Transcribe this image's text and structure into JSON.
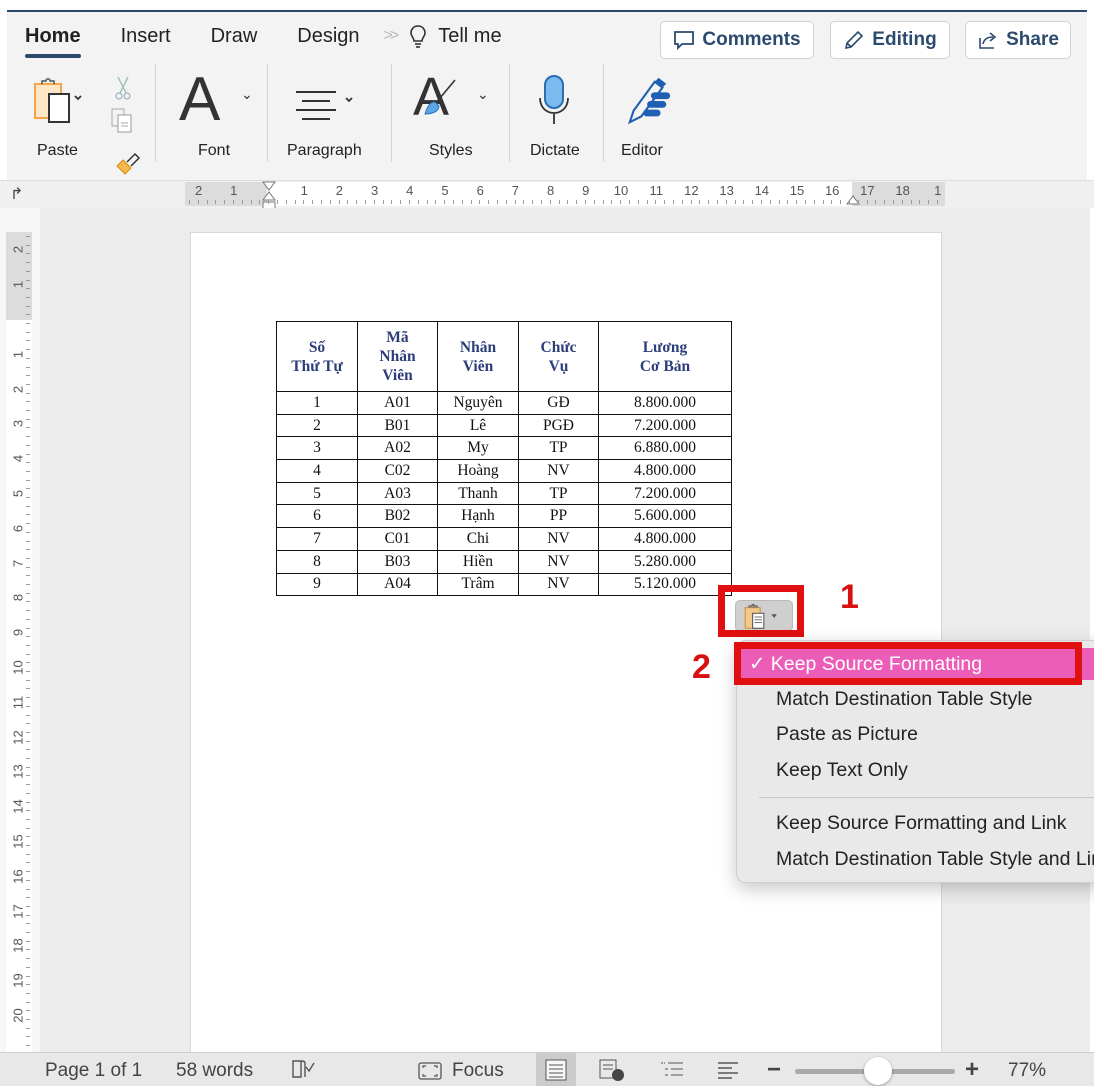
{
  "ribbon": {
    "tabs": [
      {
        "label": "Home",
        "active": true
      },
      {
        "label": "Insert",
        "active": false
      },
      {
        "label": "Draw",
        "active": false
      },
      {
        "label": "Design",
        "active": false
      }
    ],
    "overflow_icon": "double-chevron-right-icon",
    "tell_me": {
      "icon": "lightbulb-icon",
      "label": "Tell me"
    },
    "buttons": {
      "comments": {
        "icon": "comment-icon",
        "label": "Comments"
      },
      "editing": {
        "icon": "pencil-icon",
        "label": "Editing"
      },
      "share": {
        "icon": "share-icon",
        "label": "Share"
      }
    },
    "groups": {
      "paste": {
        "label": "Paste",
        "icon": "clipboard-icon"
      },
      "cut_icon": "scissors-icon",
      "copy_icon": "copy-icon",
      "format_painter_icon": "format-painter-icon",
      "font": {
        "label": "Font",
        "glyph": "A"
      },
      "paragraph": {
        "label": "Paragraph",
        "icon": "align-center-icon"
      },
      "styles": {
        "label": "Styles",
        "glyph": "A"
      },
      "dictate": {
        "label": "Dictate",
        "icon": "microphone-icon"
      },
      "editor": {
        "label": "Editor",
        "icon": "editor-pen-icon"
      }
    },
    "accent_color": "#2b4a6b"
  },
  "ruler": {
    "horizontal_labels": [
      "2",
      "1",
      "1",
      "2",
      "3",
      "4",
      "5",
      "6",
      "7",
      "8",
      "9",
      "10",
      "11",
      "12",
      "13",
      "14",
      "15",
      "16",
      "17",
      "18",
      "1"
    ],
    "vertical_labels": [
      "2",
      "1",
      "1",
      "2",
      "3",
      "4",
      "5",
      "6",
      "7",
      "8",
      "9",
      "10",
      "11",
      "12",
      "13",
      "14",
      "15",
      "16",
      "17",
      "18",
      "19",
      "20"
    ]
  },
  "table": {
    "headers": [
      [
        "Số",
        "Thứ Tự"
      ],
      [
        "Mã",
        "Nhân",
        "Viên"
      ],
      [
        "Nhân",
        "Viên"
      ],
      [
        "Chức",
        "Vụ"
      ],
      [
        "Lương",
        "Cơ Bản"
      ]
    ],
    "rows": [
      [
        "1",
        "A01",
        "Nguyên",
        "GĐ",
        "8.800.000"
      ],
      [
        "2",
        "B01",
        "Lê",
        "PGĐ",
        "7.200.000"
      ],
      [
        "3",
        "A02",
        "My",
        "TP",
        "6.880.000"
      ],
      [
        "4",
        "C02",
        "Hoàng",
        "NV",
        "4.800.000"
      ],
      [
        "5",
        "A03",
        "Thanh",
        "TP",
        "7.200.000"
      ],
      [
        "6",
        "B02",
        "Hạnh",
        "PP",
        "5.600.000"
      ],
      [
        "7",
        "C01",
        "Chi",
        "NV",
        "4.800.000"
      ],
      [
        "8",
        "B03",
        "Hiền",
        "NV",
        "5.280.000"
      ],
      [
        "9",
        "A04",
        "Trâm",
        "NV",
        "5.120.000"
      ]
    ],
    "header_color": "#2c3e7a"
  },
  "paste_options": {
    "button_icon": "paste-options-icon",
    "annotation_1": "1",
    "annotation_2": "2",
    "menu": {
      "items": [
        {
          "label": "Keep Source Formatting",
          "checked": true,
          "check_glyph": "✓"
        },
        {
          "label": "Match Destination Table Style",
          "checked": false
        },
        {
          "label": "Paste as Picture",
          "checked": false
        },
        {
          "label": "Keep Text Only",
          "checked": false
        },
        {
          "label": "Keep Source Formatting and Link",
          "checked": false
        },
        {
          "label": "Match Destination Table Style and Link",
          "checked": false
        }
      ]
    },
    "highlight_color": "#ec5db8",
    "annotation_color": "#e01010"
  },
  "statusbar": {
    "page": "Page 1 of 1",
    "words": "58 words",
    "proofing_icon": "proofing-book-icon",
    "focus": {
      "icon": "focus-icon",
      "label": "Focus"
    },
    "views": [
      "print-layout-icon",
      "web-layout-icon",
      "outline-icon",
      "draft-icon"
    ],
    "zoom_minus": "−",
    "zoom_plus": "+",
    "zoom_percent": 77,
    "zoom_label": "77%"
  }
}
